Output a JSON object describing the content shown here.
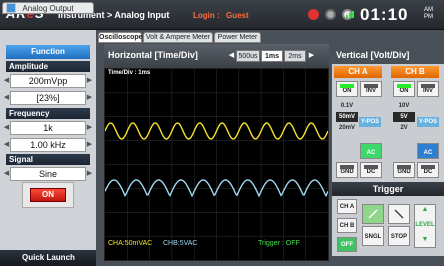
{
  "header": {
    "logo_prefix": "AR",
    "logo_mid": "e",
    "logo_suffix": "S",
    "breadcrumb": "Instrument > Analog Input",
    "login_label": "Login :",
    "user_label": "Guest",
    "clock": "01:10",
    "am": "AM",
    "pm": "PM"
  },
  "left_panel": {
    "tab": "Analog Output",
    "function_label": "Function",
    "amplitude": {
      "label": "Amplitude",
      "value": "200mVpp",
      "percent": "[23%]"
    },
    "frequency": {
      "label": "Frequency",
      "value": "1k",
      "unit_value": "1.00 kHz"
    },
    "signal": {
      "label": "Signal",
      "value": "Sine"
    },
    "on_button": "ON",
    "quick_launch": "Quick Launch"
  },
  "tabs": [
    {
      "label": "Oscilloscope",
      "active": true
    },
    {
      "label": "Volt & Ampere Meter",
      "active": false
    },
    {
      "label": "Power Meter",
      "active": false
    }
  ],
  "horizontal": {
    "title": "Horizontal [Time/Div]",
    "options": [
      "500us",
      "1ms",
      "2ms"
    ],
    "selected": "1ms"
  },
  "screen": {
    "time_div": "Time/Div : 1ms",
    "cha_reading": "CHA:50mVAC",
    "chb_reading": "CHB:5VAC",
    "trigger_status": "Trigger : OFF",
    "trace_a_color": "#f5e22a",
    "trace_b_color": "#9fd8f0"
  },
  "vertical": {
    "title": "Vertical [Volt/Div]",
    "ch_a": {
      "label": "CH A",
      "on": "ON",
      "inv": "INV",
      "volts": [
        "0.1V",
        "50mV",
        "20mV"
      ],
      "selected": "50mV",
      "ypos": "Y-POS",
      "ac": "AC",
      "gnd": "GND",
      "dc": "DC"
    },
    "ch_b": {
      "label": "CH B",
      "on": "ON",
      "inv": "INV",
      "volts": [
        "10V",
        "5V",
        "2V"
      ],
      "selected": "5V",
      "ypos": "Y-POS",
      "ac": "AC",
      "gnd": "GND",
      "dc": "DC"
    }
  },
  "trigger": {
    "title": "Trigger",
    "cha": "CH A",
    "chb": "CH B",
    "off": "OFF",
    "sngl": "SNGL",
    "stop": "STOP",
    "level": "LEVEL"
  },
  "colors": {
    "accent_orange": "#e06600",
    "accent_blue": "#1e6fc0",
    "on_red": "#c01810",
    "status_green": "#3ee04a"
  }
}
